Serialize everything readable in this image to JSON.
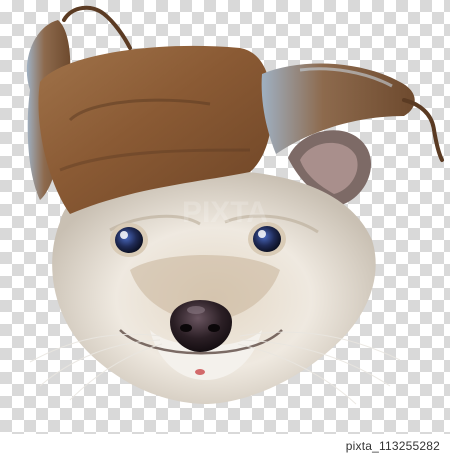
{
  "image": {
    "watermark_text": "PIXTA",
    "stock_id": "pixta_113255282",
    "colors": {
      "hat_fur": "#8a5a34",
      "hat_shadow": "#5a3a22",
      "face_fur": "#ece6dc",
      "face_shade": "#bfb3a2",
      "eye": "#1f2a55",
      "nose": "#2b1f25",
      "ear_inner": "#a98f8c"
    }
  }
}
